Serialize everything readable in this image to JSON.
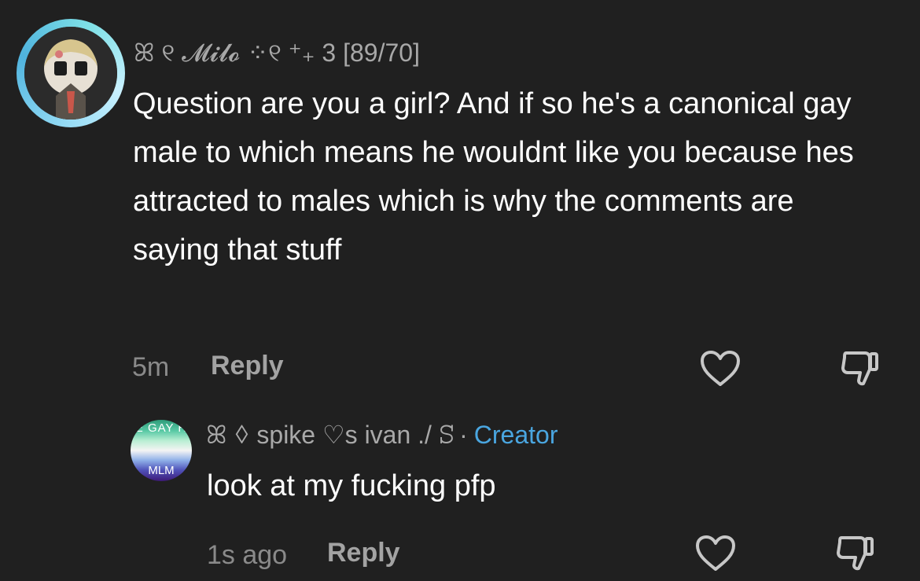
{
  "comments": [
    {
      "username": "ꕤ ୧ 𝓜𝓲𝓵𝓸 ⁘୧ ⁺₊ 3 [89/70]",
      "text": "Question are you a girl? And if so he's a canonical gay male to which means he wouldnt like you because hes attracted to males which is why the comments are saying that stuff",
      "time": "5m",
      "reply_label": "Reply"
    },
    {
      "username": "ꕤ ꕺ spike ♡s ivan ./ ꕶ",
      "badge": "Creator",
      "badge_separator": "·",
      "avatar_text_top": "E GAY H",
      "avatar_text_bottom": "MLM",
      "text": "look at my fucking pfp",
      "time": "1s ago",
      "reply_label": "Reply"
    }
  ],
  "colors": {
    "background": "#202020",
    "text": "#ffffff",
    "meta": "#8a8a8a",
    "creator": "#4aa6e0"
  },
  "icons": [
    "heart-icon",
    "dislike-icon"
  ]
}
